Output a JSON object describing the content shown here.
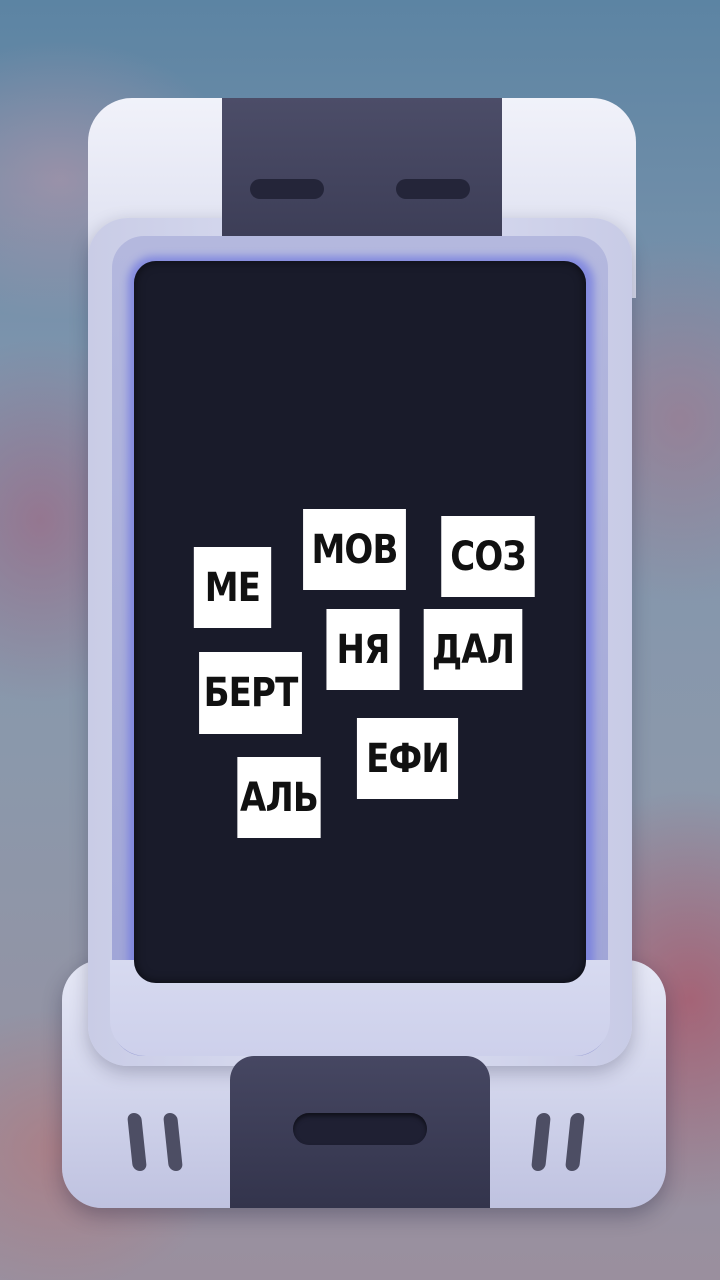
{
  "game": {
    "syllables": [
      {
        "id": "me",
        "text": "МЕ"
      },
      {
        "id": "mov",
        "text": "МОВ"
      },
      {
        "id": "soz",
        "text": "СОЗ"
      },
      {
        "id": "nya",
        "text": "НЯ"
      },
      {
        "id": "dal",
        "text": "ДАЛ"
      },
      {
        "id": "bert",
        "text": "БЕРТ"
      },
      {
        "id": "efi",
        "text": "ЕФИ"
      },
      {
        "id": "al",
        "text": "АЛЬ"
      }
    ]
  },
  "colors": {
    "screen": "#191b2a",
    "device": "#dcdff2",
    "strap": "#3a3b54",
    "tile": "#ffffff",
    "tile_text": "#111111"
  }
}
